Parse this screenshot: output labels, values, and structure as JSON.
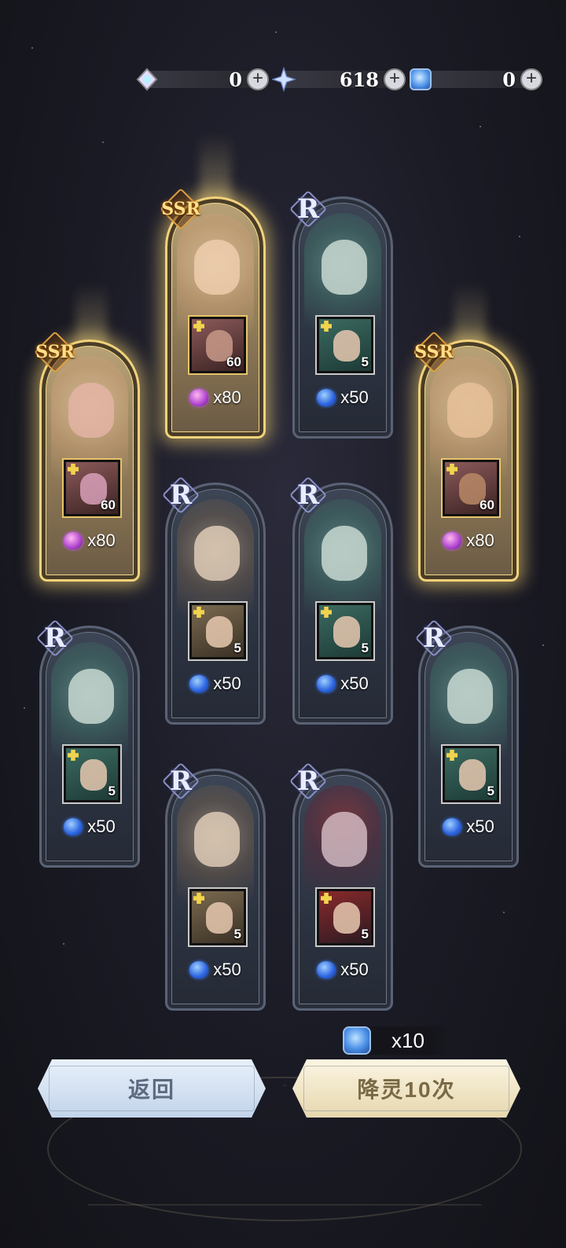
{
  "currencies": [
    {
      "name": "rainbow-crystal",
      "value": "0",
      "color": "#d8c6ff"
    },
    {
      "name": "star-diamond",
      "value": "618",
      "color": "#9ec4ff"
    },
    {
      "name": "summon-ticket",
      "value": "0",
      "color": "#6aa8ff"
    }
  ],
  "cards": [
    {
      "rarity": "SSR",
      "level": "60",
      "reward": "x80"
    },
    {
      "rarity": "SSR",
      "level": "60",
      "reward": "x80"
    },
    {
      "rarity": "R",
      "level": "5",
      "reward": "x50"
    },
    {
      "rarity": "SSR",
      "level": "60",
      "reward": "x80"
    },
    {
      "rarity": "R",
      "level": "5",
      "reward": "x50"
    },
    {
      "rarity": "R",
      "level": "5",
      "reward": "x50"
    },
    {
      "rarity": "R",
      "level": "5",
      "reward": "x50"
    },
    {
      "rarity": "R",
      "level": "5",
      "reward": "x50"
    },
    {
      "rarity": "R",
      "level": "5",
      "reward": "x50"
    },
    {
      "rarity": "R",
      "level": "5",
      "reward": "x50"
    }
  ],
  "cost": {
    "amount": "x10"
  },
  "buttons": {
    "back": "返回",
    "summon": "降灵10次"
  }
}
